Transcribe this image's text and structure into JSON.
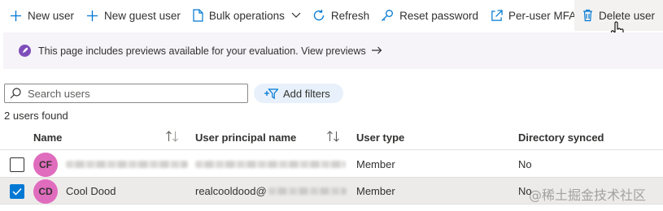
{
  "toolbar": {
    "new_user": "New user",
    "new_guest_user": "New guest user",
    "bulk_operations": "Bulk operations",
    "refresh": "Refresh",
    "reset_password": "Reset password",
    "per_user_mfa": "Per-user MFA",
    "delete_user": "Delete user"
  },
  "banner": {
    "text": "This page includes previews available for your evaluation. View previews"
  },
  "search": {
    "placeholder": "Search users"
  },
  "filters": {
    "add_label": "Add filters"
  },
  "users_found": "2 users found",
  "table": {
    "columns": [
      "Name",
      "User principal name",
      "User type",
      "Directory synced"
    ],
    "rows": [
      {
        "initials": "CF",
        "name": "",
        "upn": "",
        "user_type": "Member",
        "directory_synced": "No",
        "selected": false
      },
      {
        "initials": "CD",
        "name": "Cool Dood",
        "upn": "realcooldood@",
        "user_type": "Member",
        "directory_synced": "No",
        "selected": true
      }
    ]
  },
  "watermark": "@稀土掘金技术社区",
  "colors": {
    "accent": "#0078d4",
    "avatar": "#e06cbe",
    "banner_bg": "#f6f3f9",
    "preview_icon": "#7f4dbb"
  },
  "icons": [
    "plus-icon",
    "document-icon",
    "chevron-down-icon",
    "refresh-icon",
    "key-icon",
    "external-link-icon",
    "trash-icon",
    "rocket-icon",
    "arrow-right-icon",
    "search-icon",
    "filter-icon",
    "sort-icon",
    "checkmark-icon"
  ]
}
